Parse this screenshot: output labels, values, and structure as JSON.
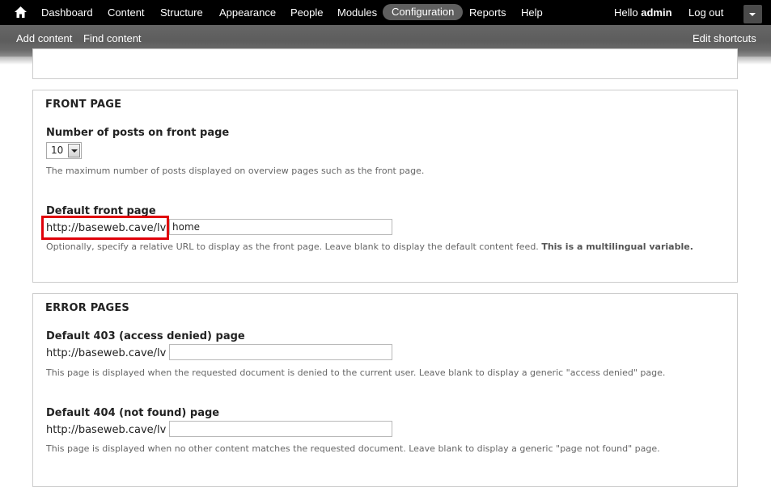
{
  "toolbar": {
    "items": [
      "Dashboard",
      "Content",
      "Structure",
      "Appearance",
      "People",
      "Modules",
      "Configuration",
      "Reports",
      "Help"
    ],
    "active": "Configuration",
    "hello_prefix": "Hello",
    "username": "admin",
    "logout": "Log out"
  },
  "shortcuts": {
    "items": [
      "Add content",
      "Find content"
    ],
    "edit": "Edit shortcuts"
  },
  "front_page": {
    "legend": "FRONT PAGE",
    "posts_label": "Number of posts on front page",
    "posts_value": "10",
    "posts_desc": "The maximum number of posts displayed on overview pages such as the front page.",
    "default_label": "Default front page",
    "default_prefix": "http://baseweb.cave/lv",
    "default_value": "home",
    "default_desc": "Optionally, specify a relative URL to display as the front page. Leave blank to display the default content feed.",
    "default_desc_bold": "This is a multilingual variable."
  },
  "error_pages": {
    "legend": "ERROR PAGES",
    "p403_label": "Default 403 (access denied) page",
    "p403_prefix": "http://baseweb.cave/lv",
    "p403_value": "",
    "p403_desc": "This page is displayed when the requested document is denied to the current user. Leave blank to display a generic \"access denied\" page.",
    "p404_label": "Default 404 (not found) page",
    "p404_prefix": "http://baseweb.cave/lv",
    "p404_value": "",
    "p404_desc": "This page is displayed when no other content matches the requested document. Leave blank to display a generic \"page not found\" page."
  },
  "colors": {
    "toolbar_bg": "#000000",
    "shortcuts_bg": "#666666",
    "active_pill": "#5f5f5f",
    "highlight": "#e0000a"
  }
}
